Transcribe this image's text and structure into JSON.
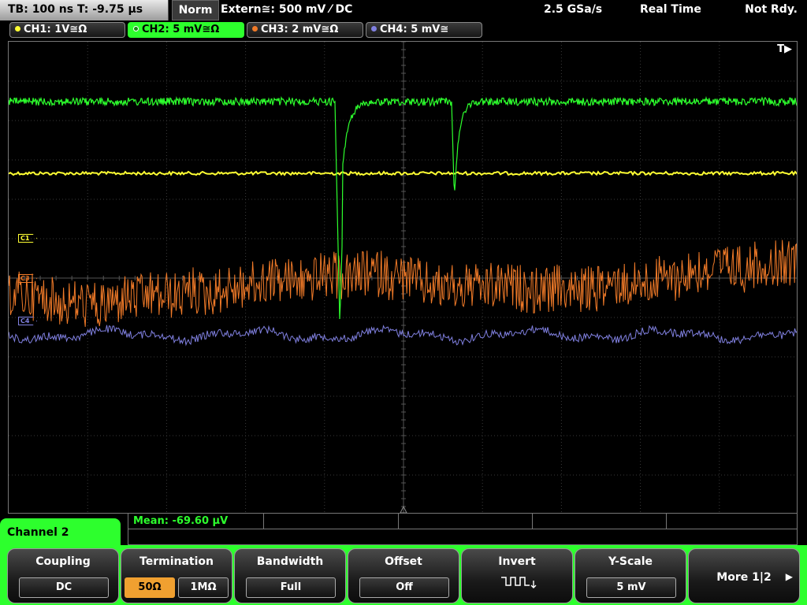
{
  "topbar": {
    "timebase": "TB: 100 ns   T: -9.75 µs",
    "acq_mode": "Norm",
    "trigger": "Extern≅: 500 mV ⁄ DC",
    "sample_rate": "2.5 GSa/s",
    "realtime": "Real Time",
    "status": "Not Rdy."
  },
  "channels": [
    {
      "label": "CH1: 1V≅Ω",
      "color": "#ffff33"
    },
    {
      "label": "CH2: 5 mV≅Ω",
      "color": "#2dff2d"
    },
    {
      "label": "CH3: 2 mV≅Ω",
      "color": "#f07a28"
    },
    {
      "label": "CH4: 5 mV≅",
      "color": "#8080e0"
    }
  ],
  "grid": {
    "trigger_marker": "T▶",
    "channel_markers": {
      "c1": "C1",
      "c3": "C3",
      "c4": "C4"
    }
  },
  "measurement": {
    "mean": "Mean: -69.60 µV"
  },
  "menu": {
    "title": "Channel 2",
    "coupling": {
      "label": "Coupling",
      "value": "DC"
    },
    "termination": {
      "label": "Termination",
      "options": [
        "50Ω",
        "1MΩ"
      ],
      "selected": "50Ω"
    },
    "bandwidth": {
      "label": "Bandwidth",
      "value": "Full"
    },
    "offset": {
      "label": "Offset",
      "value": "Off"
    },
    "invert": {
      "label": "Invert",
      "icon": "invert-waveform-icon"
    },
    "yscale": {
      "label": "Y-Scale",
      "value": "5 mV"
    },
    "more": {
      "label": "More 1|2"
    }
  }
}
